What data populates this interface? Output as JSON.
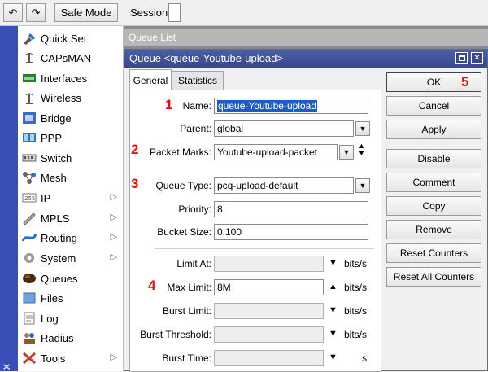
{
  "toolbar": {
    "undo_icon": "undo-icon",
    "redo_icon": "redo-icon",
    "safe_mode": "Safe Mode",
    "session_label": "Session:"
  },
  "brand": {
    "text": "X"
  },
  "sidebar": {
    "items": [
      {
        "label": "Quick Set",
        "icon": "quickset-icon",
        "submenu": false
      },
      {
        "label": "CAPsMAN",
        "icon": "capsman-icon",
        "submenu": false
      },
      {
        "label": "Interfaces",
        "icon": "interfaces-icon",
        "submenu": false
      },
      {
        "label": "Wireless",
        "icon": "wireless-icon",
        "submenu": false
      },
      {
        "label": "Bridge",
        "icon": "bridge-icon",
        "submenu": false
      },
      {
        "label": "PPP",
        "icon": "ppp-icon",
        "submenu": false
      },
      {
        "label": "Switch",
        "icon": "switch-icon",
        "submenu": false
      },
      {
        "label": "Mesh",
        "icon": "mesh-icon",
        "submenu": false
      },
      {
        "label": "IP",
        "icon": "ip-icon",
        "submenu": true
      },
      {
        "label": "MPLS",
        "icon": "mpls-icon",
        "submenu": true
      },
      {
        "label": "Routing",
        "icon": "routing-icon",
        "submenu": true
      },
      {
        "label": "System",
        "icon": "system-icon",
        "submenu": true
      },
      {
        "label": "Queues",
        "icon": "queues-icon",
        "submenu": false
      },
      {
        "label": "Files",
        "icon": "files-icon",
        "submenu": false
      },
      {
        "label": "Log",
        "icon": "log-icon",
        "submenu": false
      },
      {
        "label": "Radius",
        "icon": "radius-icon",
        "submenu": false
      },
      {
        "label": "Tools",
        "icon": "tools-icon",
        "submenu": true
      }
    ]
  },
  "queue_list": {
    "title": "Queue List"
  },
  "dialog": {
    "title": "Queue <queue-Youtube-upload>",
    "tabs": [
      "General",
      "Statistics"
    ],
    "active_tab": "General",
    "fields": {
      "name": {
        "label": "Name:",
        "value": "queue-Youtube-upload"
      },
      "parent": {
        "label": "Parent:",
        "value": "global"
      },
      "packet_marks": {
        "label": "Packet Marks:",
        "value": "Youtube-upload-packet"
      },
      "queue_type": {
        "label": "Queue Type:",
        "value": "pcq-upload-default"
      },
      "priority": {
        "label": "Priority:",
        "value": "8"
      },
      "bucket_size": {
        "label": "Bucket Size:",
        "value": "0.100"
      },
      "limit_at": {
        "label": "Limit At:",
        "value": "",
        "unit": "bits/s"
      },
      "max_limit": {
        "label": "Max Limit:",
        "value": "8M",
        "unit": "bits/s"
      },
      "burst_limit": {
        "label": "Burst Limit:",
        "value": "",
        "unit": "bits/s"
      },
      "burst_threshold": {
        "label": "Burst Threshold:",
        "value": "",
        "unit": "bits/s"
      },
      "burst_time": {
        "label": "Burst Time:",
        "value": "",
        "unit": "s"
      }
    },
    "buttons": [
      "OK",
      "Cancel",
      "Apply",
      "Disable",
      "Comment",
      "Copy",
      "Remove",
      "Reset Counters",
      "Reset All Counters"
    ]
  },
  "annotations": [
    "1",
    "2",
    "3",
    "4",
    "5"
  ],
  "colors": {
    "title_bar": "#3f4f99",
    "brand_strip": "#3a4fb5",
    "annotation": "#e01010",
    "selection": "#1f5bc5"
  }
}
